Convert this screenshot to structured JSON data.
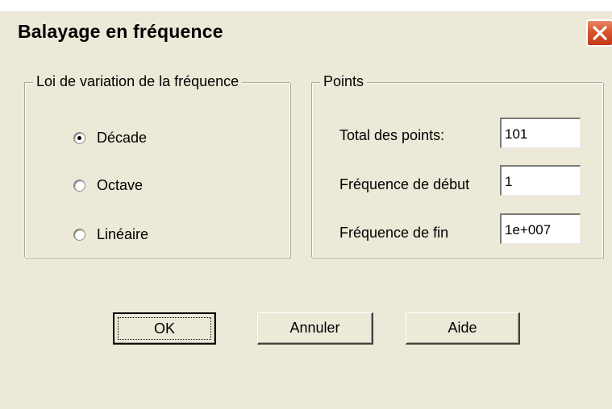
{
  "window": {
    "title": "Balayage en fréquence"
  },
  "variation_group": {
    "label": "Loi de variation de la fréquence",
    "options": [
      {
        "label": "Décade",
        "checked": true
      },
      {
        "label": "Octave",
        "checked": false
      },
      {
        "label": "Linéaire",
        "checked": false
      }
    ]
  },
  "points_group": {
    "label": "Points",
    "total_label": "Total  des points:",
    "total_value": "101",
    "start_label": "Fréquence de début",
    "start_value": "1",
    "end_label": "Fréquence de fin",
    "end_value": "1e+007"
  },
  "buttons": {
    "ok": "OK",
    "cancel": "Annuler",
    "help": "Aide"
  },
  "icons": {
    "close": "close-icon"
  },
  "colors": {
    "dialog_bg": "#ece9d8",
    "close_button": "#d9532f"
  }
}
